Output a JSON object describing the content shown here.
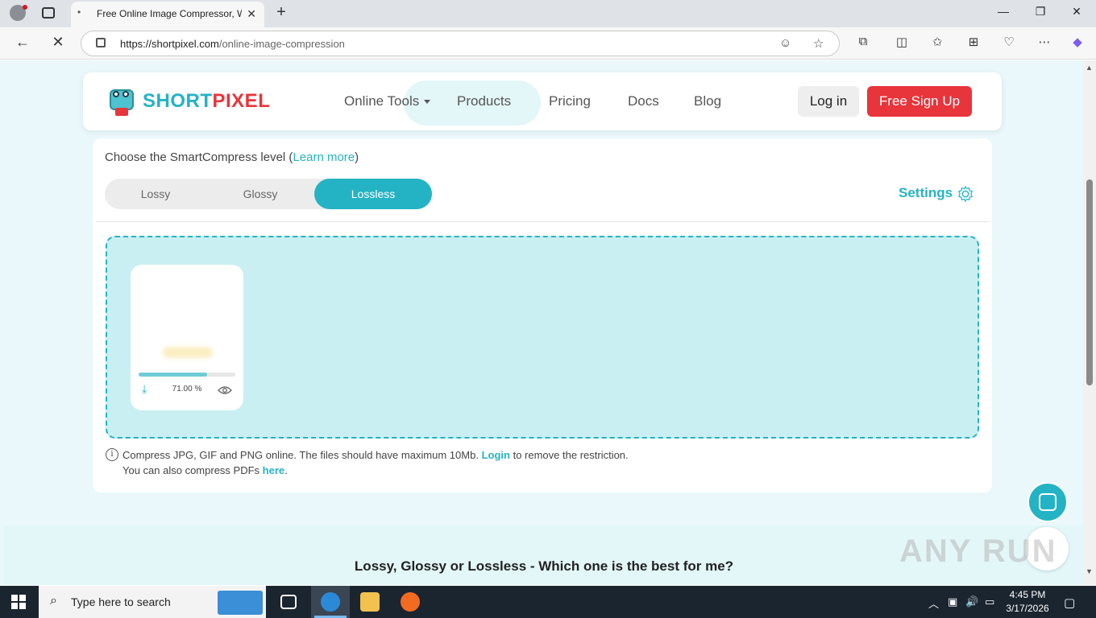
{
  "browser": {
    "tab_title": "Free Online Image Compressor, W",
    "url_domain": "https://shortpixel.com",
    "url_path": "/online-image-compression"
  },
  "header": {
    "brand_part1": "SHORT",
    "brand_part2": "PIXEL",
    "nav": {
      "online_tools": "Online Tools",
      "products": "Products",
      "pricing": "Pricing",
      "docs": "Docs",
      "blog": "Blog"
    },
    "login": "Log in",
    "signup": "Free Sign Up"
  },
  "compressor": {
    "choose_prefix": "Choose the SmartCompress level (",
    "learn_more": "Learn more",
    "choose_suffix": ")",
    "levels": [
      "Lossy",
      "Glossy",
      "Lossless"
    ],
    "active_level": "Lossless",
    "settings": "Settings",
    "file": {
      "progress_percent": 71,
      "progress_label": "71.00 %"
    },
    "info_line1_a": "Compress JPG, GIF and PNG online. The files should have maximum 10Mb.",
    "info_login": "Login",
    "info_line1_b": "to remove the restriction.",
    "info_line2_a": "You can also compress PDFs",
    "info_here": "here",
    "info_line2_b": "."
  },
  "section2": {
    "title": "Lossy, Glossy or Lossless - Which one is the best for me?"
  },
  "watermark": "ANY RUN",
  "taskbar": {
    "search_placeholder": "Type here to search",
    "time": "4:45 PM",
    "date": "3/17/2026"
  },
  "colors": {
    "accent": "#24b3c4",
    "brand_red": "#e8343b",
    "dropzone_bg": "#c9eff2"
  }
}
